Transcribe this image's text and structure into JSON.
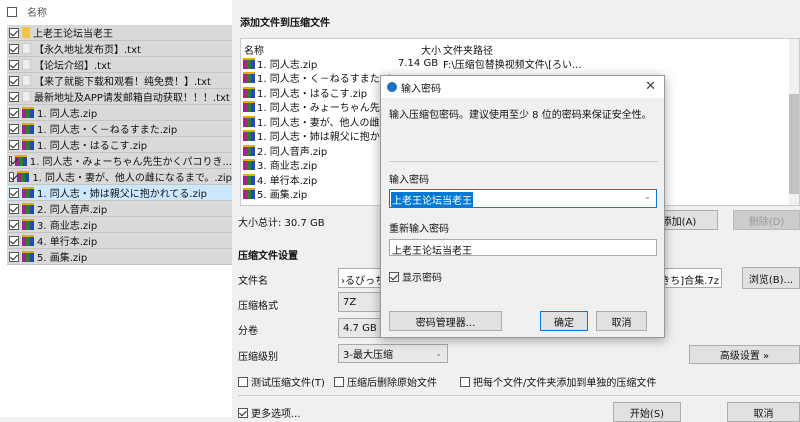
{
  "left_panel": {
    "header": "名称",
    "rows": [
      {
        "name": "上老王论坛当老王",
        "type": "folder"
      },
      {
        "name": "【永久地址发布页】.txt",
        "type": "txt"
      },
      {
        "name": "【论坛介绍】.txt",
        "type": "txt"
      },
      {
        "name": "【来了就能下载和观看！纯免费！】.txt",
        "type": "txt"
      },
      {
        "name": "最新地址及APP请发邮箱自动获取！！！.txt",
        "type": "txt"
      },
      {
        "name": "1. 同人志.zip",
        "type": "zip"
      },
      {
        "name": "1. 同人志・く－ねるすまた.zip",
        "type": "zip"
      },
      {
        "name": "1. 同人志・はるこす.zip",
        "type": "zip"
      },
      {
        "name": "1. 同人志・みょーちゃん先生かくパコりき...",
        "type": "zip"
      },
      {
        "name": "1. 同人志・妻が、他人の雌になるまで。.zip",
        "type": "zip"
      },
      {
        "name": "1. 同人志・姉は親父に抱かれてる.zip",
        "type": "zip",
        "selected": true
      },
      {
        "name": "2. 同人音声.zip",
        "type": "zip"
      },
      {
        "name": "3. 商业志.zip",
        "type": "zip"
      },
      {
        "name": "4. 单行本.zip",
        "type": "zip"
      },
      {
        "name": "5. 画集.zip",
        "type": "zip"
      }
    ]
  },
  "main": {
    "title": "添加文件到压缩文件",
    "columns": {
      "name": "名称",
      "size": "大小",
      "path": "文件夹路径"
    },
    "files": [
      {
        "name": "1. 同人志.zip",
        "size": "7.14 GB",
        "path": "F:\\压缩包替换视频文件\\[ろい..."
      },
      {
        "name": "1. 同人志・く－ねるすまた.zip"
      },
      {
        "name": "1. 同人志・はるこす.zip"
      },
      {
        "name": "1. 同人志・みょーちゃん先生"
      },
      {
        "name": "1. 同人志・妻が、他人の雌に"
      },
      {
        "name": "1. 同人志・姉は親父に抱かれ"
      },
      {
        "name": "2. 同人音声.zip"
      },
      {
        "name": "3. 商业志.zip"
      },
      {
        "name": "4. 单行本.zip"
      },
      {
        "name": "5. 画集.zip"
      }
    ],
    "total": "大小总计: 30.7 GB",
    "add": "添加(A)",
    "delete": "删除(D)",
    "settings_title": "压缩文件设置",
    "filename_label": "文件名",
    "filename_left": "›るぴっち",
    "filename_right": "ゅきち]合集.7z",
    "browse": "浏览(B)...",
    "format_label": "压缩格式",
    "format": "7Z",
    "split_label": "分卷",
    "split": "4.7 GB (D",
    "level_label": "压缩级别",
    "level": "3-最大压缩",
    "advanced": "高级设置 »",
    "opt_test": "测试压缩文件(T)",
    "opt_delete": "压缩后删除原始文件",
    "opt_separate": "把每个文件/文件夹添加到单独的压缩文件",
    "more": "更多选项...",
    "start": "开始(S)",
    "cancel": "取消"
  },
  "dialog": {
    "title": "输入密码",
    "desc": "输入压缩包密码。建议使用至少 8 位的密码来保证安全性。",
    "pw_label": "输入密码",
    "pw": "上老王论坛当老王",
    "re_label": "重新输入密码",
    "re": "上老王论坛当老王",
    "show": "显示密码",
    "manager": "密码管理器...",
    "ok": "确定",
    "cancel": "取消"
  }
}
